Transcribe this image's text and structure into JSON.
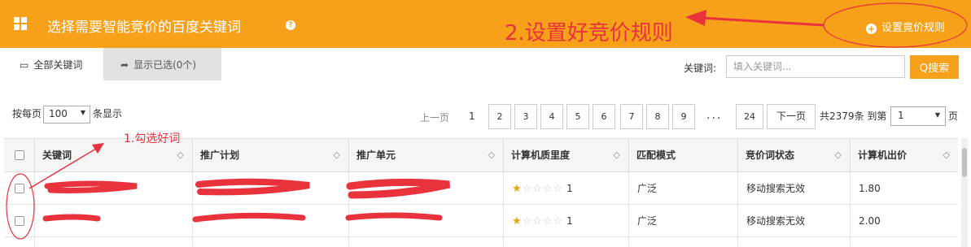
{
  "header": {
    "title": "选择需要智能竞价的百度关键词",
    "help_icon": "?",
    "settings_label": "设置竟价规则",
    "settings_icon": "+"
  },
  "annotations": {
    "step2": "2.设置好竞价规则",
    "step1": "1.勾选好词",
    "color": "#e8323c"
  },
  "tabs": {
    "all_keywords": "全部关键词",
    "show_selected": "显示已选(0个)"
  },
  "search": {
    "label": "关键词:",
    "placeholder": "填入关键词...",
    "button": "Q搜索"
  },
  "per_page": {
    "prefix": "按每页",
    "value": "100",
    "suffix": "条显示"
  },
  "pagination": {
    "prev": "上一页",
    "first": "1",
    "pages": [
      "2",
      "3",
      "4",
      "5",
      "6",
      "7",
      "8",
      "9"
    ],
    "ellipsis": "...",
    "last": "24",
    "next": "下一页",
    "total": "共2379条 到第",
    "goto_value": "1",
    "page_suffix": "页"
  },
  "table": {
    "columns": [
      "关键词",
      "推广计划",
      "推广单元",
      "计算机质里度",
      "匹配模式",
      "竞价词状态",
      "计算机出价"
    ],
    "sort_icon": "◇",
    "rows": [
      {
        "quality": "1",
        "match": "广泛",
        "status": "移动搜索无效",
        "bid": "1.80"
      },
      {
        "quality": "1",
        "match": "广泛",
        "status": "移动搜索无效",
        "bid": "2.00"
      }
    ]
  },
  "colors": {
    "brand": "#f7a11a",
    "annotation": "#e8323c"
  }
}
